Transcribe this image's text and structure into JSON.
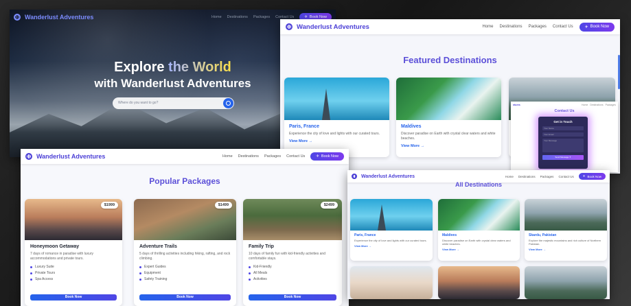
{
  "hero_window": {
    "brand": "Wanderlust Adventures",
    "nav": [
      "Home",
      "Destinations",
      "Packages",
      "Contact Us"
    ],
    "book_label": "Book Now",
    "title_line1_a": "Explore ",
    "title_line1_b": "the World",
    "title_line2": "with Wanderlust Adventures",
    "search_placeholder": "Where do you want to go?"
  },
  "featured_window": {
    "brand": "Wanderlust Adventures",
    "nav": [
      "Home",
      "Destinations",
      "Packages",
      "Contact Us"
    ],
    "book_label": "Book Now",
    "heading": "Featured Destinations",
    "cards": [
      {
        "title": "Paris, France",
        "desc": "Experience the city of love and lights with our curated tours.",
        "link": "View More →"
      },
      {
        "title": "Maldives",
        "desc": "Discover paradise on Earth with crystal clear waters and white beaches.",
        "link": "View More →"
      }
    ],
    "contact": {
      "mini_brand": "ntures",
      "mini_nav": [
        "Home",
        "Destinations",
        "Packages"
      ],
      "heading": "Contact Us",
      "form_title": "Get in Touch",
      "name_ph": "Your Name",
      "email_ph": "Your Email",
      "message_ph": "Your Message",
      "send_label": "Send Message ✈"
    }
  },
  "packages_window": {
    "brand": "Wanderlust Adventures",
    "nav": [
      "Home",
      "Destinations",
      "Packages",
      "Contact Us"
    ],
    "book_label": "Book Now",
    "heading": "Popular Packages",
    "cards": [
      {
        "price": "$1999",
        "title": "Honeymoon Getaway",
        "desc": "7 days of romance in paradise with luxury accommodations and private tours.",
        "features": [
          "Luxury Suite",
          "Private Tours",
          "Spa Access"
        ],
        "button": "Book Now"
      },
      {
        "price": "$1499",
        "title": "Adventure Trails",
        "desc": "5 days of thrilling activities including hiking, rafting, and rock climbing.",
        "features": [
          "Expert Guides",
          "Equipment",
          "Safety Training"
        ],
        "button": "Book Now"
      },
      {
        "price": "$2499",
        "title": "Family Trip",
        "desc": "10 days of family fun with kid-friendly activities and comfortable stays.",
        "features": [
          "Kid-Friendly",
          "All Meals",
          "Activities"
        ],
        "button": "Book Now"
      }
    ]
  },
  "all_window": {
    "brand": "Wanderlust Adventures",
    "nav": [
      "Home",
      "Destinations",
      "Packages",
      "Contact Us"
    ],
    "book_label": "Book Now",
    "heading": "All Destinations",
    "cards": [
      {
        "title": "Paris, France",
        "desc": "Experience the city of love and lights with our curated tours.",
        "link": "View More →"
      },
      {
        "title": "Maldives",
        "desc": "Discover paradise on Earth with crystal clear waters and white beaches.",
        "link": "View More →"
      },
      {
        "title": "Skardu, Pakistan",
        "desc": "Explore the majestic mountains and rich culture of Northern Pakistan.",
        "link": "View More →"
      }
    ]
  },
  "colors": {
    "accent": "#4f46e5",
    "brand": "#4b3fd6",
    "heading": "#5b4fd8",
    "link": "#2563eb"
  }
}
